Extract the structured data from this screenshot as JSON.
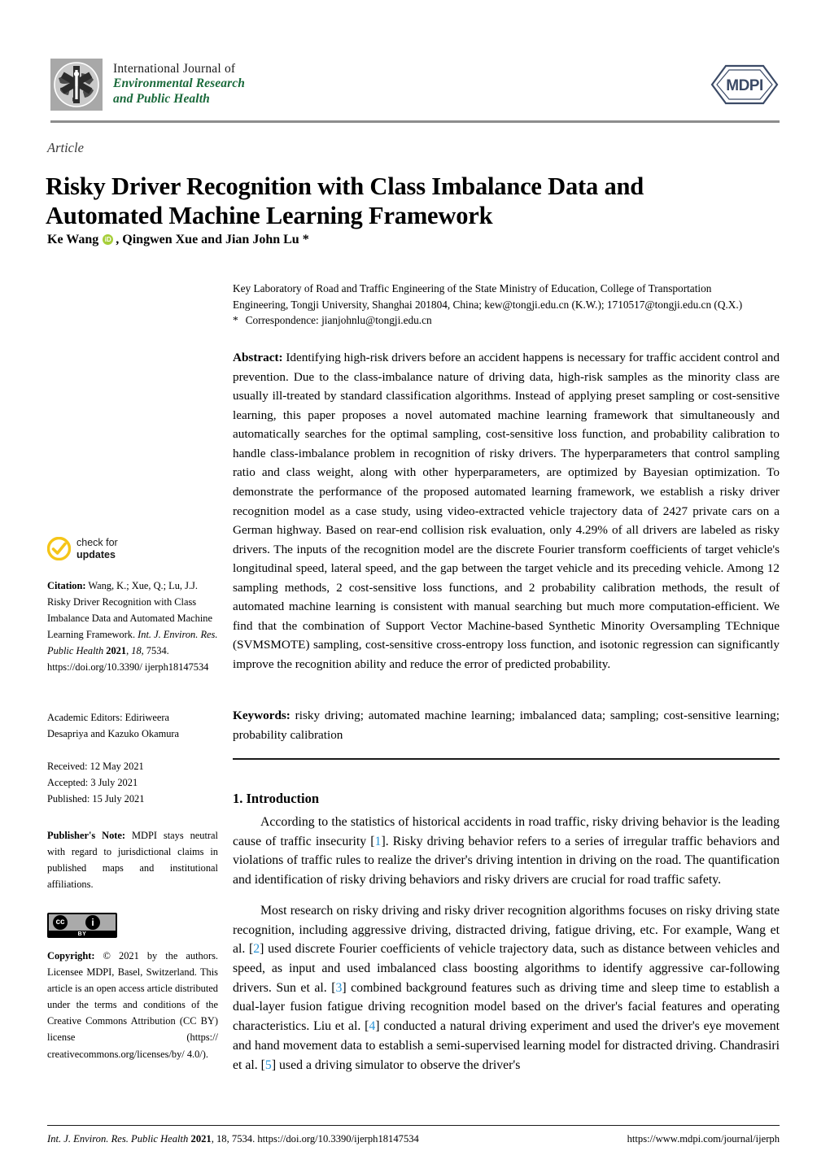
{
  "masthead": {
    "journal_line1": "International Journal of",
    "journal_line2": "Environmental Research",
    "journal_line3": "and Public Health",
    "publisher_logo_text": "MDPI",
    "journal_accent_color": "#19693a",
    "publisher_logo_color": "#3b4a66"
  },
  "article": {
    "kind": "Article",
    "title": "Risky Driver Recognition with Class Imbalance Data and Automated Machine Learning Framework",
    "authors_pre": "Ke Wang",
    "orcid_glyph": "iD",
    "authors_post": ", Qingwen Xue and Jian John Lu *"
  },
  "affiliation": {
    "line1": "Key Laboratory of Road and Traffic Engineering of the State Ministry of Education, College of Transportation",
    "line2": "Engineering, Tongji University, Shanghai 201804, China; kew@tongji.edu.cn (K.W.); 1710517@tongji.edu.cn (Q.X.)",
    "corr_marker": "*",
    "corr_text": "Correspondence: jianjohnlu@tongji.edu.cn"
  },
  "abstract": {
    "label": "Abstract:",
    "text": " Identifying high-risk drivers before an accident happens is necessary for traffic accident control and prevention. Due to the class-imbalance nature of driving data, high-risk samples as the minority class are usually ill-treated by standard classification algorithms. Instead of applying preset sampling or cost-sensitive learning, this paper proposes a novel automated machine learning framework that simultaneously and automatically searches for the optimal sampling, cost-sensitive loss function, and probability calibration to handle class-imbalance problem in recognition of risky drivers. The hyperparameters that control sampling ratio and class weight, along with other hyperparameters, are optimized by Bayesian optimization. To demonstrate the performance of the proposed automated learning framework, we establish a risky driver recognition model as a case study, using video-extracted vehicle trajectory data of 2427 private cars on a German highway. Based on rear-end collision risk evaluation, only 4.29% of all drivers are labeled as risky drivers. The inputs of the recognition model are the discrete Fourier transform coefficients of target vehicle's longitudinal speed, lateral speed, and the gap between the target vehicle and its preceding vehicle. Among 12 sampling methods, 2 cost-sensitive loss functions, and 2 probability calibration methods, the result of automated machine learning is consistent with manual searching but much more computation-efficient. We find that the combination of Support Vector Machine-based Synthetic Minority Oversampling TEchnique (SVMSMOTE) sampling, cost-sensitive cross-entropy loss function, and isotonic regression can significantly improve the recognition ability and reduce the error of predicted probability."
  },
  "keywords": {
    "label": "Keywords:",
    "text": " risky driving; automated machine learning; imbalanced data; sampling; cost-sensitive learning; probability calibration"
  },
  "introduction": {
    "heading": "1. Introduction",
    "para1_a": "According to the statistics of historical accidents in road traffic, risky driving behavior is the leading cause of traffic insecurity [",
    "para1_ref1": "1",
    "para1_b": "]. Risky driving behavior refers to a series of irregular traffic behaviors and violations of traffic rules to realize the driver's driving intention in driving on the road. The quantification and identification of risky driving behaviors and risky drivers are crucial for road traffic safety.",
    "para2_a": "Most research on risky driving and risky driver recognition algorithms focuses on risky driving state recognition, including aggressive driving, distracted driving, fatigue driving, etc. For example, Wang et al. [",
    "para2_ref2": "2",
    "para2_b": "] used discrete Fourier coefficients of vehicle trajectory data, such as distance between vehicles and speed, as input and used imbalanced class boosting algorithms to identify aggressive car-following drivers. Sun et al. [",
    "para2_ref3": "3",
    "para2_c": "] combined background features such as driving time and sleep time to establish a dual-layer fusion fatigue driving recognition model based on the driver's facial features and operating characteristics. Liu et al. [",
    "para2_ref4": "4",
    "para2_d": "] conducted a natural driving experiment and used the driver's eye movement and hand movement data to establish a semi-supervised learning model for distracted driving. Chandrasiri et al. [",
    "para2_ref5": "5",
    "para2_e": "] used a driving simulator to observe the driver's",
    "ref_link_color": "#2a94d6"
  },
  "sidebar": {
    "check_updates_line1": "check for",
    "check_updates_line2": "updates",
    "check_updates_color": "#f5c518",
    "citation_label": "Citation:",
    "citation_a": " Wang, K.; Xue, Q.; Lu, J.J. Risky Driver Recognition with Class Imbalance Data and Automated Machine Learning Framework. ",
    "citation_journal": "Int. J. Environ. Res. Public Health",
    "citation_year": "2021",
    "citation_b": ", ",
    "citation_vol": "18",
    "citation_c": ", 7534. https://doi.org/10.3390/ ijerph18147534",
    "editors_line1": "Academic Editors: Ediriweera",
    "editors_line2": "Desapriya and Kazuko Okamura",
    "received": "Received: 12 May 2021",
    "accepted": "Accepted: 3 July 2021",
    "published": "Published: 15 July 2021",
    "pubnote_label": "Publisher's Note:",
    "pubnote_text": " MDPI stays neutral with regard to jurisdictional claims in published maps and institutional affiliations.",
    "cc_cc_glyph": "cc",
    "cc_by_glyph": "i",
    "cc_by_label": "BY",
    "copyright_label": "Copyright:",
    "copyright_text": " © 2021 by the authors. Licensee MDPI, Basel, Switzerland. This article is an open access article distributed under the terms and conditions of the Creative Commons Attribution (CC BY) license (https:// creativecommons.org/licenses/by/ 4.0/)."
  },
  "footer": {
    "left_journal": "Int. J. Environ. Res. Public Health",
    "left_year": "2021",
    "left_rest": ", 18, 7534. https://doi.org/10.3390/ijerph18147534",
    "right": "https://www.mdpi.com/journal/ijerph"
  }
}
